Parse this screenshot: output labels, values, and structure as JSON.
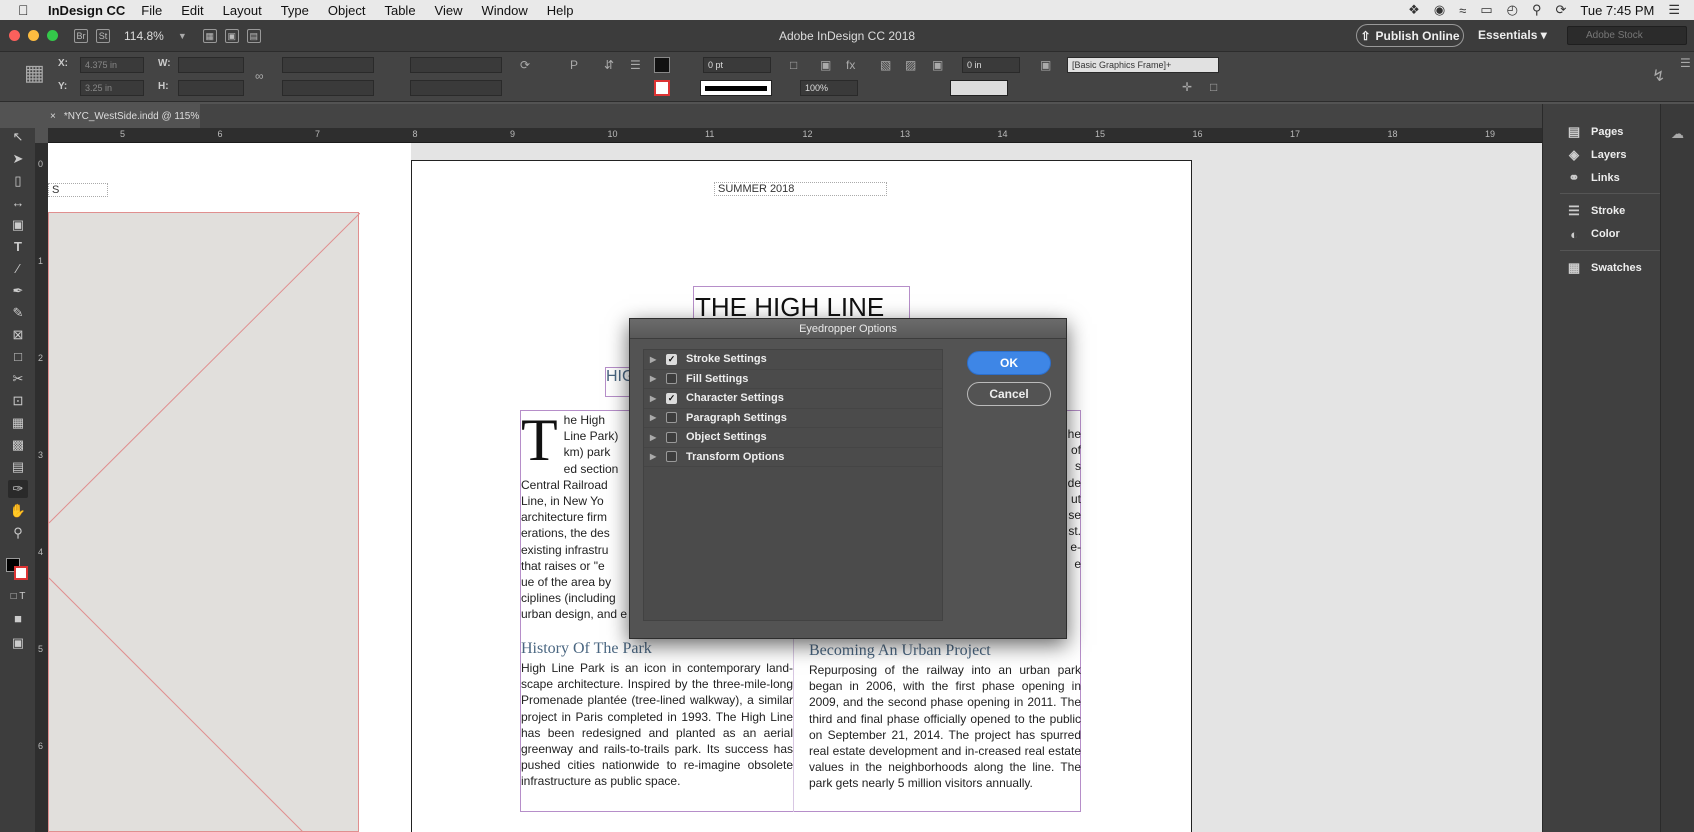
{
  "menubar": {
    "app": "InDesign CC",
    "items": [
      "File",
      "Edit",
      "Layout",
      "Type",
      "Object",
      "Table",
      "View",
      "Window",
      "Help"
    ],
    "clock": "Tue 7:45 PM"
  },
  "appbar": {
    "zoom": "114.8%",
    "title": "Adobe InDesign CC 2018",
    "publish": "Publish Online",
    "workspace": "Essentials",
    "stock_placeholder": "Adobe Stock"
  },
  "control": {
    "x_value": "4.375 in",
    "y_value": "3.25 in",
    "stroke_weight": "0 pt",
    "scale": "100%",
    "offset": "0 in",
    "object_style": "[Basic Graphics Frame]+"
  },
  "document": {
    "tab": "*NYC_WestSide.indd @ 115%"
  },
  "ruler": {
    "h": [
      "5",
      "6",
      "7",
      "8",
      "9",
      "10",
      "11",
      "12",
      "13",
      "14",
      "15",
      "16",
      "17",
      "18",
      "19"
    ],
    "v": [
      "0",
      "1",
      "2",
      "3",
      "4",
      "5",
      "6"
    ]
  },
  "page": {
    "left_label": "S",
    "folio": "SUMMER 2018",
    "headline": "THE HIGH LINE",
    "sub_label": "HIG",
    "col1_lines": [
      "he High",
      "Line Park)",
      "km) park",
      "ed section",
      "Central Railroad",
      "Line, in New Yo",
      "architecture firm",
      "erations, the des",
      "existing infrastru",
      "that raises or \"e",
      "ue of the area by",
      "ciplines (including",
      "urban design, and e"
    ],
    "col2_fragments": [
      "he",
      "of",
      "s",
      "de",
      "ut",
      "se",
      "st.",
      "e-",
      "e"
    ],
    "history_title": "History Of The Park",
    "history_body": "High Line Park is an icon in contemporary land-scape architecture. Inspired by the three-mile-long Promenade plantée (tree-lined walkway), a similar project in Paris completed in 1993. The High Line has been redesigned and planted as an aerial greenway and rails-to-trails park. Its success has pushed cities nationwide to re-imagine obsolete infrastructure as public space.",
    "urban_title": "Becoming An Urban Project",
    "urban_body": "Repurposing of the railway into an urban park began in 2006, with the first phase opening in 2009, and the second phase opening in 2011. The third and final phase officially opened to the public on September 21, 2014. The project has spurred real estate development and in-creased real estate values in the neighborhoods along the line. The park gets nearly 5 million visitors annually."
  },
  "panels": [
    {
      "label": "Pages",
      "icon": "pages-icon"
    },
    {
      "label": "Layers",
      "icon": "layers-icon"
    },
    {
      "label": "Links",
      "icon": "links-icon"
    },
    {
      "label": "Stroke",
      "icon": "stroke-icon"
    },
    {
      "label": "Color",
      "icon": "color-icon"
    },
    {
      "label": "Swatches",
      "icon": "swatches-icon"
    }
  ],
  "dialog": {
    "title": "Eyedropper Options",
    "rows": [
      {
        "label": "Stroke Settings",
        "checked": true
      },
      {
        "label": "Fill Settings",
        "checked": false
      },
      {
        "label": "Character Settings",
        "checked": true
      },
      {
        "label": "Paragraph Settings",
        "checked": false
      },
      {
        "label": "Object Settings",
        "checked": false
      },
      {
        "label": "Transform Options",
        "checked": false
      }
    ],
    "ok": "OK",
    "cancel": "Cancel"
  },
  "colors": {
    "accent": "#3e86e6",
    "frame_guide": "#b68ec9",
    "subhead": "#4a6681"
  }
}
